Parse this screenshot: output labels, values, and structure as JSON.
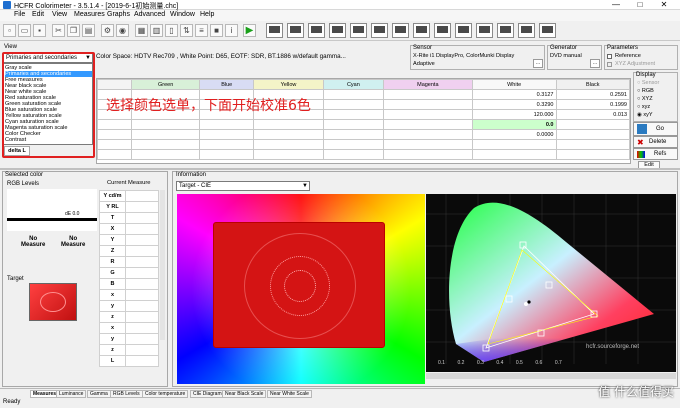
{
  "window": {
    "title": "HCFR Colorimeter - 3.5.1.4 - [2019-6-1初始测量.chc]",
    "controls": [
      "—",
      "□",
      "✕"
    ]
  },
  "menu": [
    "File",
    "Edit",
    "View",
    "Measures",
    "Graphs",
    "Advanced",
    "Window",
    "Help"
  ],
  "view_panel": {
    "label": "View",
    "selected": "Primaries and secondaries",
    "options": [
      "Gray scale",
      "Primaries and secondaries",
      "Free measures",
      "Near black scale",
      "Near white scale",
      "Red saturation scale",
      "Green saturation scale",
      "Blue saturation scale",
      "Yellow saturation scale",
      "Cyan saturation scale",
      "Magenta saturation scale",
      "Color Checker",
      "Contrast"
    ],
    "selected_index": 1,
    "delta_label": "delta L"
  },
  "color_space_text": "Color Space: HDTV Rec709 , White Point: D65, EOTF:  SDR, BT.1886 w/default gamma...",
  "sensor": {
    "label": "Sensor",
    "name": "X-Rite i1 DisplayPro, ColorMunki Display",
    "mode": "Adaptive"
  },
  "generator": {
    "label": "Generator",
    "name": "DVD manual"
  },
  "parameters": {
    "label": "Parameters",
    "reference": "Reference",
    "xyz_adjust": "XYZ Adjustment"
  },
  "measure_table": {
    "columns": [
      "Green",
      "Blue",
      "Yellow",
      "Cyan",
      "Magenta",
      "White",
      "Black"
    ],
    "rows": [
      {
        "white": "0.3127",
        "black": "0.2591"
      },
      {
        "white": "0.3290",
        "black": "0.1999"
      },
      {
        "white": "120.000",
        "black": "0.013"
      },
      {
        "white": "0.0",
        "black": ""
      },
      {
        "white": "0.0000",
        "black": ""
      }
    ]
  },
  "display_panel": {
    "label": "Display",
    "options": [
      "Sensor",
      "RGB",
      "XYZ",
      "xyz",
      "xyY"
    ],
    "selected": "xyY"
  },
  "side_buttons": {
    "go": "Go",
    "delete": "Delete",
    "refs": "Refs",
    "edit": "Edit"
  },
  "annotation": "选择颜色选单，下面开始校准6色",
  "selected_color": {
    "label": "Selected color",
    "rgb_levels": "RGB Levels",
    "dE": "dE 0.0",
    "no_measure_left": "No\nMeasure",
    "no_measure_right": "No\nMeasure",
    "target": "Target",
    "current_measure": "Current Measure",
    "fields": [
      "Y cd/m",
      "Y RL",
      "T",
      "X",
      "Y",
      "Z",
      "R",
      "G",
      "B",
      "x",
      "y",
      "z",
      "x",
      "y",
      "z",
      "L"
    ]
  },
  "information": {
    "label": "Information",
    "target_select": "Target - CIE",
    "site": "hcfr.sourceforge.net",
    "axis_labels": [
      "0.1",
      "0.2",
      "0.3",
      "0.4",
      "0.5",
      "0.6",
      "0.7"
    ]
  },
  "tabs": [
    "Measures",
    "Luminance",
    "Gamma",
    "RGB Levels",
    "Color temperature",
    "CIE Diagram",
    "Near Black Scale",
    "Near White Scale"
  ],
  "status": "Ready",
  "watermark": "值 什么值得买",
  "colors": {
    "annotation_red": "#e02020",
    "selection_blue": "#3399ff",
    "patch_red": "#d41414",
    "highlight_green": "#ccffcc"
  }
}
